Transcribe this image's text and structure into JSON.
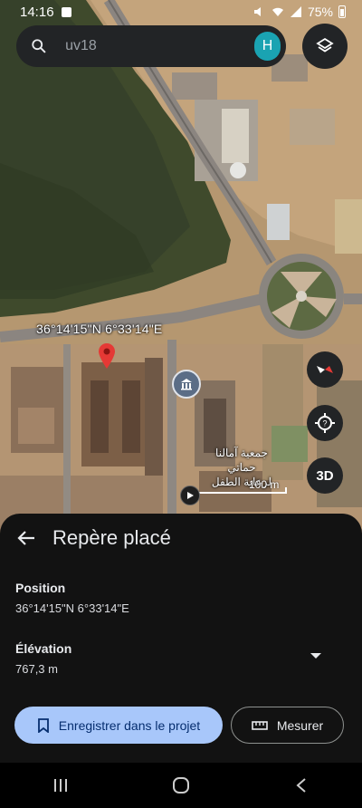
{
  "status_bar": {
    "time": "14:16",
    "battery": "75%"
  },
  "search": {
    "query": "uv18",
    "avatar_letter": "H"
  },
  "map": {
    "pin_coordinates": "36°14'15\"N 6°33'14\"E",
    "poi_label_line1": "جمعية آمالنا حماتي",
    "poi_label_line2": "لرعاية الطفل",
    "scale_label": "100 m",
    "three_d_label": "3D"
  },
  "sheet": {
    "title": "Repère placé",
    "position_label": "Position",
    "position_value": "36°14'15\"N 6°33'14\"E",
    "elevation_label": "Élévation",
    "elevation_value": "767,3 m",
    "save_button": "Enregistrer dans le projet",
    "measure_button": "Mesurer"
  },
  "colors": {
    "accent": "#a8c7fa",
    "pin": "#e53935",
    "avatar": "#1aa3b2"
  },
  "icons": [
    "search-icon",
    "layers-icon",
    "compass-icon",
    "locate-icon",
    "back-icon",
    "bookmark-icon",
    "ruler-icon",
    "recents-icon",
    "home-icon",
    "back-nav-icon"
  ]
}
